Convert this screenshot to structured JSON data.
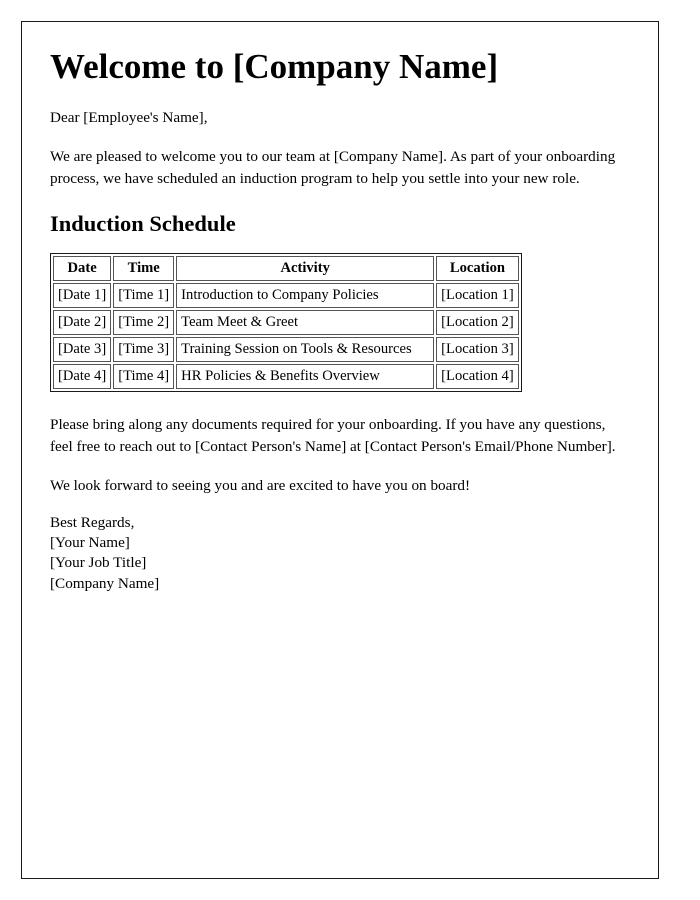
{
  "document": {
    "title": "Welcome to [Company Name]",
    "salutation": "Dear [Employee's Name],",
    "intro_paragraph": "We are pleased to welcome you to our team at [Company Name]. As part of your onboarding process, we have scheduled an induction program to help you settle into your new role.",
    "schedule_heading": "Induction Schedule",
    "closing_paragraph": "Please bring along any documents required for your onboarding. If you have any questions, feel free to reach out to [Contact Person's Name] at [Contact Person's Email/Phone Number].",
    "final_paragraph": "We look forward to seeing you and are excited to have you on board!",
    "signature": {
      "regards": "Best Regards,",
      "name": "[Your Name]",
      "job_title": "[Your Job Title]",
      "company": "[Company Name]"
    }
  },
  "table": {
    "headers": [
      "Date",
      "Time",
      "Activity",
      "Location"
    ],
    "rows": [
      {
        "date": "[Date 1]",
        "time": "[Time 1]",
        "activity": "Introduction to Company Policies",
        "location": "[Location 1]"
      },
      {
        "date": "[Date 2]",
        "time": "[Time 2]",
        "activity": "Team Meet & Greet",
        "location": "[Location 2]"
      },
      {
        "date": "[Date 3]",
        "time": "[Time 3]",
        "activity": "Training Session on Tools & Resources",
        "location": "[Location 3]"
      },
      {
        "date": "[Date 4]",
        "time": "[Time 4]",
        "activity": "HR Policies & Benefits Overview",
        "location": "[Location 4]"
      }
    ]
  },
  "colors": {
    "page_border": "#1a1a1a",
    "table_border": "#555555",
    "text": "#000000",
    "background": "#ffffff"
  }
}
